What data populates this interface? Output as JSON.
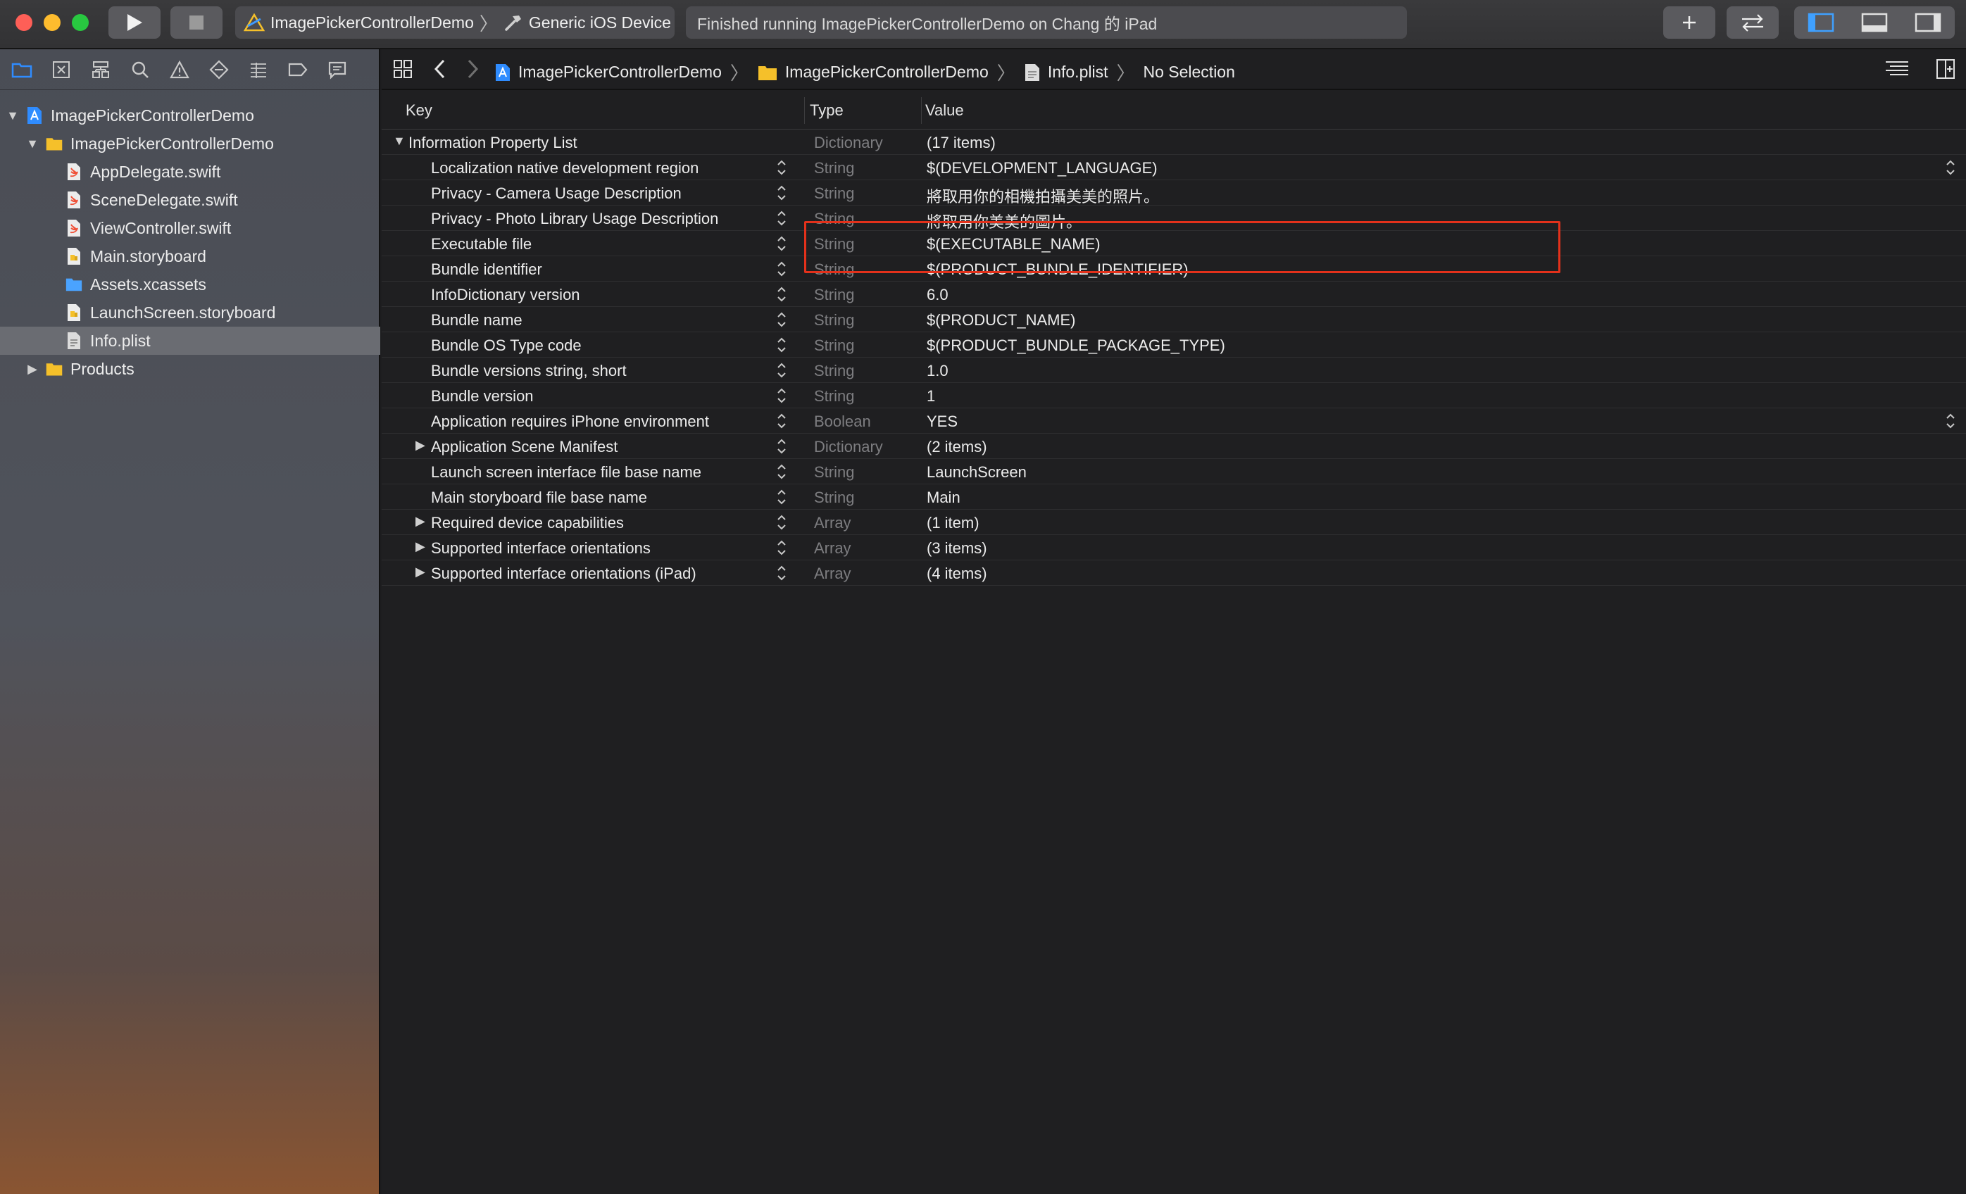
{
  "toolbar": {
    "scheme_name": "ImagePickerControllerDemo",
    "device": "Generic iOS Device",
    "activity_status": "Finished running ImagePickerControllerDemo on Chang 的 iPad"
  },
  "navigator": {
    "items": [
      {
        "label": "ImagePickerControllerDemo",
        "kind": "project",
        "indent": 0,
        "disclosure": "open"
      },
      {
        "label": "ImagePickerControllerDemo",
        "kind": "folder",
        "indent": 1,
        "disclosure": "open"
      },
      {
        "label": "AppDelegate.swift",
        "kind": "swift",
        "indent": 2,
        "disclosure": ""
      },
      {
        "label": "SceneDelegate.swift",
        "kind": "swift",
        "indent": 2,
        "disclosure": ""
      },
      {
        "label": "ViewController.swift",
        "kind": "swift",
        "indent": 2,
        "disclosure": ""
      },
      {
        "label": "Main.storyboard",
        "kind": "storyboard",
        "indent": 2,
        "disclosure": ""
      },
      {
        "label": "Assets.xcassets",
        "kind": "assets",
        "indent": 2,
        "disclosure": ""
      },
      {
        "label": "LaunchScreen.storyboard",
        "kind": "storyboard",
        "indent": 2,
        "disclosure": ""
      },
      {
        "label": "Info.plist",
        "kind": "plist",
        "indent": 2,
        "disclosure": "",
        "selected": true
      },
      {
        "label": "Products",
        "kind": "folder",
        "indent": 1,
        "disclosure": "closed"
      }
    ]
  },
  "jumpbar": {
    "crumb_project": "ImagePickerControllerDemo",
    "crumb_folder": "ImagePickerControllerDemo",
    "crumb_file": "Info.plist",
    "crumb_selection": "No Selection"
  },
  "plist": {
    "columns": {
      "key": "Key",
      "type": "Type",
      "value": "Value"
    },
    "rows": [
      {
        "key": "Information Property List",
        "type": "Dictionary",
        "value": "(17 items)",
        "level": 0,
        "disclosure": "open"
      },
      {
        "key": "Localization native development region",
        "type": "String",
        "value": "$(DEVELOPMENT_LANGUAGE)",
        "level": 1,
        "value_stepper": true
      },
      {
        "key": "Privacy - Camera Usage Description",
        "type": "String",
        "value": "將取用你的相機拍攝美美的照片。",
        "level": 1
      },
      {
        "key": "Privacy - Photo Library Usage Description",
        "type": "String",
        "value": "將取用你美美的圖片。",
        "level": 1
      },
      {
        "key": "Executable file",
        "type": "String",
        "value": "$(EXECUTABLE_NAME)",
        "level": 1
      },
      {
        "key": "Bundle identifier",
        "type": "String",
        "value": "$(PRODUCT_BUNDLE_IDENTIFIER)",
        "level": 1
      },
      {
        "key": "InfoDictionary version",
        "type": "String",
        "value": "6.0",
        "level": 1
      },
      {
        "key": "Bundle name",
        "type": "String",
        "value": "$(PRODUCT_NAME)",
        "level": 1
      },
      {
        "key": "Bundle OS Type code",
        "type": "String",
        "value": "$(PRODUCT_BUNDLE_PACKAGE_TYPE)",
        "level": 1
      },
      {
        "key": "Bundle versions string, short",
        "type": "String",
        "value": "1.0",
        "level": 1
      },
      {
        "key": "Bundle version",
        "type": "String",
        "value": "1",
        "level": 1
      },
      {
        "key": "Application requires iPhone environment",
        "type": "Boolean",
        "value": "YES",
        "level": 1,
        "value_stepper": true
      },
      {
        "key": "Application Scene Manifest",
        "type": "Dictionary",
        "value": "(2 items)",
        "level": 1,
        "disclosure": "closed"
      },
      {
        "key": "Launch screen interface file base name",
        "type": "String",
        "value": "LaunchScreen",
        "level": 1
      },
      {
        "key": "Main storyboard file base name",
        "type": "String",
        "value": "Main",
        "level": 1
      },
      {
        "key": "Required device capabilities",
        "type": "Array",
        "value": "(1 item)",
        "level": 1,
        "disclosure": "closed"
      },
      {
        "key": "Supported interface orientations",
        "type": "Array",
        "value": "(3 items)",
        "level": 1,
        "disclosure": "closed"
      },
      {
        "key": "Supported interface orientations (iPad)",
        "type": "Array",
        "value": "(4 items)",
        "level": 1,
        "disclosure": "closed"
      }
    ]
  },
  "colors": {
    "highlight_box": "#e3311b",
    "accent": "#2f8cff",
    "folder": "#f5c02a"
  }
}
